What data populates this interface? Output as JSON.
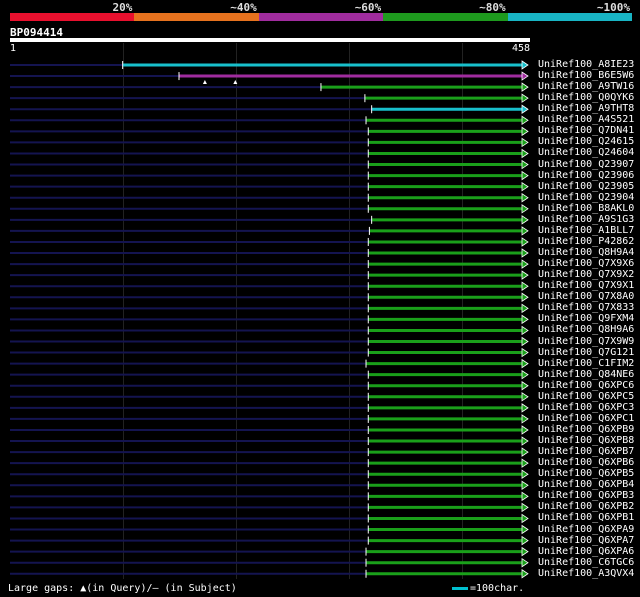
{
  "legend": {
    "labels": [
      "20%",
      "~40%",
      "~60%",
      "~80%",
      "~100%"
    ],
    "colors": [
      "#e8102e",
      "#e6721e",
      "#a02c9e",
      "#1e9a1e",
      "#18b4c4"
    ]
  },
  "query": {
    "id": "BP094414",
    "start": "1",
    "end": "458",
    "length": 458
  },
  "colors": {
    "background": "#000000",
    "line": "#0a0a30",
    "teal": "#18c0cc",
    "purple": "#a02c9e",
    "green": "#1aa01a"
  },
  "hits": [
    {
      "name": "UniRef100_A8IE23",
      "start": 100,
      "end": 458,
      "color": "teal"
    },
    {
      "name": "UniRef100_B6E5W6",
      "start": 150,
      "end": 458,
      "color": "purple",
      "gaps": [
        173,
        200
      ]
    },
    {
      "name": "UniRef100_A9TW16",
      "start": 276,
      "end": 458,
      "color": "green"
    },
    {
      "name": "UniRef100_Q0QYK6",
      "start": 315,
      "end": 458,
      "color": "green"
    },
    {
      "name": "UniRef100_A9THT8",
      "start": 321,
      "end": 458,
      "color": "teal"
    },
    {
      "name": "UniRef100_A4S521",
      "start": 316,
      "end": 458,
      "color": "green"
    },
    {
      "name": "UniRef100_Q7DN41",
      "start": 318,
      "end": 458,
      "color": "green"
    },
    {
      "name": "UniRef100_Q24615",
      "start": 318,
      "end": 458,
      "color": "green"
    },
    {
      "name": "UniRef100_Q24604",
      "start": 318,
      "end": 458,
      "color": "green"
    },
    {
      "name": "UniRef100_Q23907",
      "start": 318,
      "end": 458,
      "color": "green"
    },
    {
      "name": "UniRef100_Q23906",
      "start": 318,
      "end": 458,
      "color": "green"
    },
    {
      "name": "UniRef100_Q23905",
      "start": 318,
      "end": 458,
      "color": "green"
    },
    {
      "name": "UniRef100_Q23904",
      "start": 318,
      "end": 458,
      "color": "green"
    },
    {
      "name": "UniRef100_B8AKL0",
      "start": 318,
      "end": 458,
      "color": "green"
    },
    {
      "name": "UniRef100_A9S1G3",
      "start": 321,
      "end": 458,
      "color": "green"
    },
    {
      "name": "UniRef100_A1BLL7",
      "start": 319,
      "end": 458,
      "color": "green"
    },
    {
      "name": "UniRef100_P42862",
      "start": 318,
      "end": 458,
      "color": "green"
    },
    {
      "name": "UniRef100_Q8H9A4",
      "start": 318,
      "end": 458,
      "color": "green"
    },
    {
      "name": "UniRef100_Q7X9X6",
      "start": 318,
      "end": 458,
      "color": "green"
    },
    {
      "name": "UniRef100_Q7X9X2",
      "start": 318,
      "end": 458,
      "color": "green"
    },
    {
      "name": "UniRef100_Q7X9X1",
      "start": 318,
      "end": 458,
      "color": "green"
    },
    {
      "name": "UniRef100_Q7X8A0",
      "start": 318,
      "end": 458,
      "color": "green"
    },
    {
      "name": "UniRef100_Q7X833",
      "start": 318,
      "end": 458,
      "color": "green"
    },
    {
      "name": "UniRef100_Q9FXM4",
      "start": 318,
      "end": 458,
      "color": "green"
    },
    {
      "name": "UniRef100_Q8H9A6",
      "start": 318,
      "end": 458,
      "color": "green"
    },
    {
      "name": "UniRef100_Q7X9W9",
      "start": 318,
      "end": 458,
      "color": "green"
    },
    {
      "name": "UniRef100_Q7G121",
      "start": 318,
      "end": 458,
      "color": "green"
    },
    {
      "name": "UniRef100_C1FIM2",
      "start": 316,
      "end": 458,
      "color": "green"
    },
    {
      "name": "UniRef100_Q84NE6",
      "start": 318,
      "end": 458,
      "color": "green"
    },
    {
      "name": "UniRef100_Q6XPC6",
      "start": 318,
      "end": 458,
      "color": "green"
    },
    {
      "name": "UniRef100_Q6XPC5",
      "start": 318,
      "end": 458,
      "color": "green"
    },
    {
      "name": "UniRef100_Q6XPC3",
      "start": 318,
      "end": 458,
      "color": "green"
    },
    {
      "name": "UniRef100_Q6XPC1",
      "start": 318,
      "end": 458,
      "color": "green"
    },
    {
      "name": "UniRef100_Q6XPB9",
      "start": 318,
      "end": 458,
      "color": "green"
    },
    {
      "name": "UniRef100_Q6XPB8",
      "start": 318,
      "end": 458,
      "color": "green"
    },
    {
      "name": "UniRef100_Q6XPB7",
      "start": 318,
      "end": 458,
      "color": "green"
    },
    {
      "name": "UniRef100_Q6XPB6",
      "start": 318,
      "end": 458,
      "color": "green"
    },
    {
      "name": "UniRef100_Q6XPB5",
      "start": 318,
      "end": 458,
      "color": "green"
    },
    {
      "name": "UniRef100_Q6XPB4",
      "start": 318,
      "end": 458,
      "color": "green"
    },
    {
      "name": "UniRef100_Q6XPB3",
      "start": 318,
      "end": 458,
      "color": "green"
    },
    {
      "name": "UniRef100_Q6XPB2",
      "start": 318,
      "end": 458,
      "color": "green"
    },
    {
      "name": "UniRef100_Q6XPB1",
      "start": 318,
      "end": 458,
      "color": "green"
    },
    {
      "name": "UniRef100_Q6XPA9",
      "start": 318,
      "end": 458,
      "color": "green"
    },
    {
      "name": "UniRef100_Q6XPA7",
      "start": 318,
      "end": 458,
      "color": "green"
    },
    {
      "name": "UniRef100_Q6XPA6",
      "start": 316,
      "end": 458,
      "color": "green"
    },
    {
      "name": "UniRef100_C6TGC6",
      "start": 316,
      "end": 458,
      "color": "green"
    },
    {
      "name": "UniRef100_A3QVX4",
      "start": 316,
      "end": 458,
      "color": "green"
    }
  ],
  "footer": {
    "gaps_text": "Large gaps: ▲(in Query)/– (in Subject)",
    "scale_text": "=100char."
  }
}
